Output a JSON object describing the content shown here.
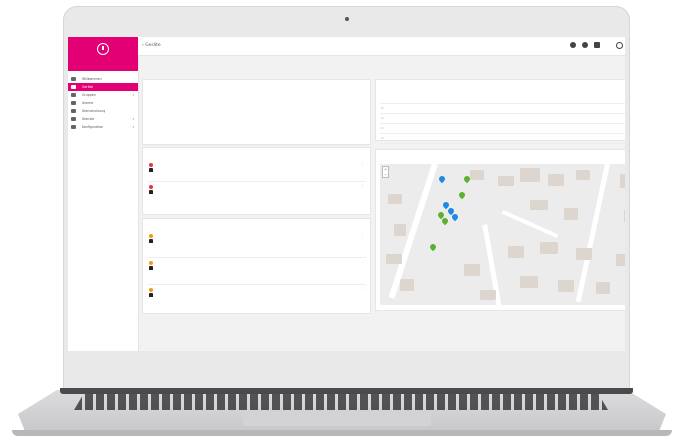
{
  "sidebar": {
    "brand": "",
    "items": [
      {
        "label": "Willkommen",
        "icon": "welcome-icon",
        "active": false,
        "has_submenu": false
      },
      {
        "label": "Geräte",
        "icon": "home-icon",
        "active": true,
        "has_submenu": false
      },
      {
        "label": "Gruppen",
        "icon": "folder-icon",
        "active": false,
        "has_submenu": true
      },
      {
        "label": "Alarme",
        "icon": "bell-icon",
        "active": false,
        "has_submenu": false
      },
      {
        "label": "Dienstnutzung",
        "icon": "chart-icon",
        "active": false,
        "has_submenu": false
      },
      {
        "label": "Dienste",
        "icon": "shield-icon",
        "active": false,
        "has_submenu": true
      },
      {
        "label": "Konfiguration",
        "icon": "wrench-icon",
        "active": false,
        "has_submenu": true
      }
    ]
  },
  "topbar": {
    "breadcrumb": "Geräte",
    "user": "",
    "icons": [
      "search-icon",
      "gear-icon",
      "apps-grid-icon",
      "user-icon"
    ]
  },
  "subbar": {
    "links": [
      "",
      "",
      ""
    ],
    "selected": ""
  },
  "welcome": {
    "title": "",
    "text": "",
    "link": ""
  },
  "devices": {
    "title": "",
    "columns": [
      "",
      "",
      ""
    ],
    "rows": [
      {
        "name": ""
      },
      {
        "name": ""
      },
      {
        "name": ""
      },
      {
        "name": ""
      }
    ]
  },
  "alarms_active": {
    "title": "",
    "items": [
      {
        "severity": "red",
        "title": "",
        "meta": ""
      },
      {
        "severity": "red",
        "title": "",
        "meta": ""
      }
    ]
  },
  "alarms_recent": {
    "title": "",
    "items": [
      {
        "severity": "orange",
        "title": "",
        "meta": ""
      },
      {
        "severity": "orange",
        "title": "",
        "meta": ""
      },
      {
        "severity": "orange",
        "title": "",
        "meta": ""
      }
    ]
  },
  "map": {
    "title": "",
    "zoom_in": "+",
    "zoom_out": "−",
    "markers": [
      "blue",
      "green",
      "blue",
      "blue",
      "green",
      "green",
      "blue",
      "green",
      "green"
    ]
  },
  "colors": {
    "accent": "#e20074",
    "link": "#2a7fd4",
    "marker_blue": "#1e88e5",
    "marker_green": "#5cb130"
  }
}
